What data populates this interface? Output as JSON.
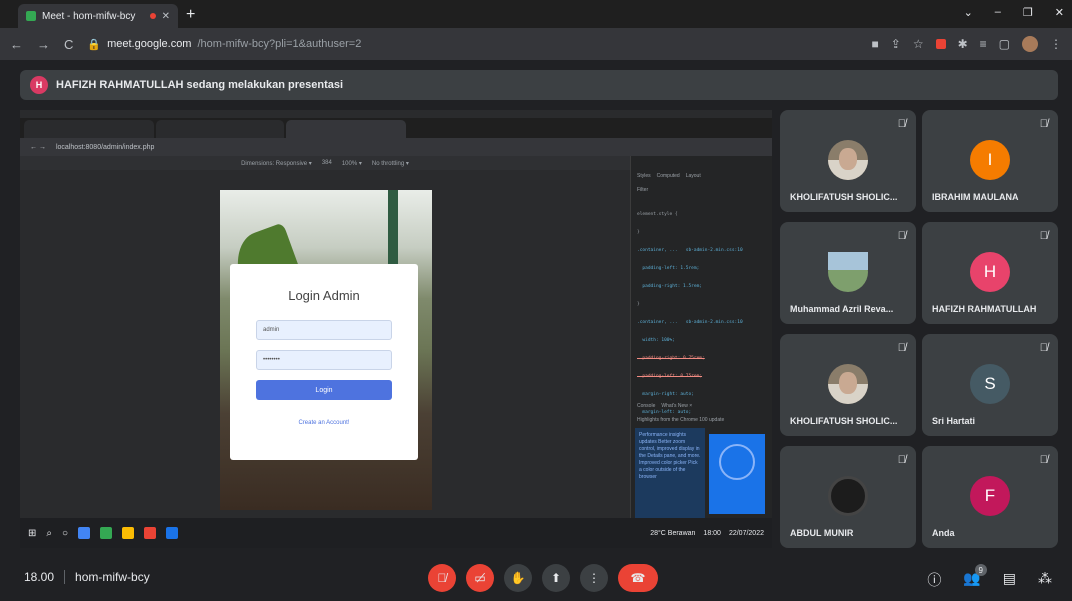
{
  "browser": {
    "tab_title": "Meet - hom-mifw-bcy",
    "url_host": "meet.google.com",
    "url_path": "/hom-mifw-bcy?pli=1&authuser=2",
    "window_controls": [
      "⌄",
      "–",
      "❐",
      "✕"
    ],
    "nav": {
      "back": "←",
      "forward": "→",
      "reload": "C"
    }
  },
  "banner": {
    "initial": "H",
    "text": "HAFIZH RAHMATULLAH sedang melakukan presentasi"
  },
  "shared_screen": {
    "inner_url": "localhost:8080/admin/index.php",
    "device_toolbar": {
      "device": "Dimensions: Responsive ▾",
      "width": "384",
      "zoom": "100% ▾",
      "throttle": "No throttling ▾"
    },
    "login": {
      "title": "Login Admin",
      "username_value": "admin",
      "password_value": "••••••••",
      "button": "Login",
      "link": "Create an Account!"
    },
    "devtools": {
      "tabs": [
        "Styles",
        "Computed",
        "Layout"
      ],
      "filter": "Filter",
      "code_lines": [
        "element.style {",
        "}",
        ".container, ...   sb-admin-2.min.css:10",
        "  padding-left: 1.5rem;",
        "  padding-right: 1.5rem;",
        "}",
        ".container, ...   sb-admin-2.min.css:10",
        "  width: 100%;",
        "  padding-right: 0.75rem;",
        "  padding-left: 0.75rem;",
        "  margin-right: auto;",
        "  margin-left: auto;"
      ],
      "drawer_tabs": [
        "Console",
        "What's New ×"
      ],
      "drawer_heading": "Highlights from the Chrome 100 update",
      "card_text": "Performance insights updates Better zoom control, improved display in the Details pane, and more. Improved color picker Pick a color outside of the browser"
    },
    "taskbar": {
      "weather": "28°C Berawan",
      "time": "18:00",
      "date": "22/07/2022"
    }
  },
  "participants": [
    {
      "name": "KHOLIFATUSH SHOLIC...",
      "avatar_type": "photo",
      "initial": "",
      "color": "#8a7d6a"
    },
    {
      "name": "IBRAHIM MAULANA",
      "avatar_type": "initial",
      "initial": "I",
      "color": "#f57c00"
    },
    {
      "name": "Muhammad Azril Reva...",
      "avatar_type": "photo-sky",
      "initial": "",
      "color": "#7e9f6d"
    },
    {
      "name": "HAFIZH RAHMATULLAH",
      "avatar_type": "initial",
      "initial": "H",
      "color": "#e8436b"
    },
    {
      "name": "KHOLIFATUSH SHOLIC...",
      "avatar_type": "photo",
      "initial": "",
      "color": "#8a7d6a"
    },
    {
      "name": "Sri Hartati",
      "avatar_type": "initial",
      "initial": "S",
      "color": "#455a64"
    },
    {
      "name": "ABDUL MUNIR",
      "avatar_type": "photo-watch",
      "initial": "",
      "color": "#1c1c1c"
    },
    {
      "name": "Anda",
      "avatar_type": "initial",
      "initial": "F",
      "color": "#c2185b"
    }
  ],
  "bottom_bar": {
    "time": "18.00",
    "meeting_code": "hom-mifw-bcy",
    "people_count": "9"
  },
  "icons": {
    "mic_off": "mic-off-icon",
    "camera_off": "camera-off-icon",
    "raise_hand": "raise-hand-icon",
    "present": "present-screen-icon",
    "more": "more-options-icon",
    "end_call": "end-call-icon",
    "info": "info-icon",
    "people": "people-icon",
    "chat": "chat-icon",
    "activities": "activities-icon"
  },
  "colors": {
    "meet_bg": "#202124",
    "tile_bg": "#3c4043",
    "danger": "#ea4335"
  }
}
